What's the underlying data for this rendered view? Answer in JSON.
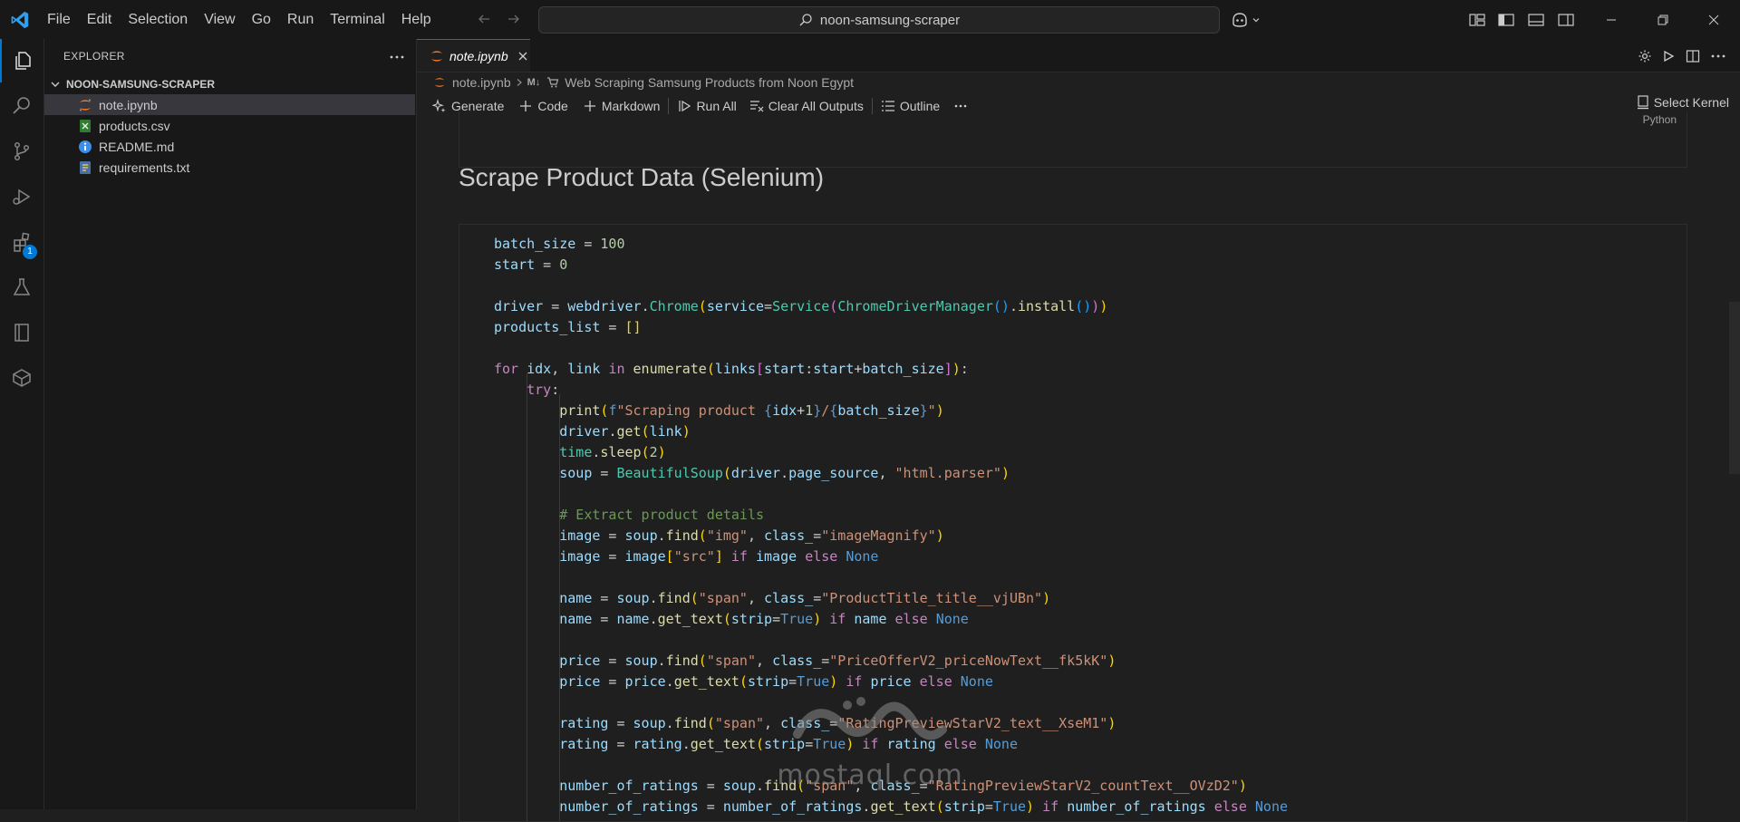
{
  "menu": [
    "File",
    "Edit",
    "Selection",
    "View",
    "Go",
    "Run",
    "Terminal",
    "Help"
  ],
  "command_center": {
    "text": "noon-samsung-scraper"
  },
  "activity_bar": {
    "extensions_badge": "1"
  },
  "sidebar": {
    "title": "EXPLORER",
    "folder": "NOON-SAMSUNG-SCRAPER",
    "files": [
      {
        "name": "note.ipynb",
        "icon": "jupyter-icon"
      },
      {
        "name": "products.csv",
        "icon": "csv-icon"
      },
      {
        "name": "README.md",
        "icon": "info-icon"
      },
      {
        "name": "requirements.txt",
        "icon": "python-file-icon"
      }
    ]
  },
  "tab": {
    "label": "note.ipynb"
  },
  "breadcrumb": {
    "file": "note.ipynb",
    "section_prefix": "M↓",
    "section": "Web Scraping Samsung Products from Noon Egypt"
  },
  "toolbar": {
    "generate": "Generate",
    "code": "Code",
    "markdown": "Markdown",
    "run_all": "Run All",
    "clear_all": "Clear All Outputs",
    "outline": "Outline",
    "select_kernel": "Select Kernel"
  },
  "cell": {
    "language": "Python"
  },
  "heading": "Scrape Product Data (Selenium)",
  "watermark": {
    "text": "mostaql.com"
  },
  "code_lines": [
    [
      [
        "v",
        "batch_size"
      ],
      [
        "",
        "&nbsp;= "
      ],
      [
        "n",
        "100"
      ]
    ],
    [
      [
        "v",
        "start"
      ],
      [
        "",
        "&nbsp;= "
      ],
      [
        "n",
        "0"
      ]
    ],
    [],
    [
      [
        "v",
        "driver"
      ],
      [
        "",
        "&nbsp;= "
      ],
      [
        "v",
        "webdriver"
      ],
      [
        "",
        "."
      ],
      [
        "c",
        "Chrome"
      ],
      [
        "p1",
        "("
      ],
      [
        "v",
        "service"
      ],
      [
        "",
        "="
      ],
      [
        "c",
        "Service"
      ],
      [
        "p2",
        "("
      ],
      [
        "c",
        "ChromeDriverManager"
      ],
      [
        "p3",
        "()"
      ],
      [
        "",
        "."
      ],
      [
        "f",
        "install"
      ],
      [
        "p3",
        "()"
      ],
      [
        "p2",
        ")"
      ],
      [
        "p1",
        ")"
      ]
    ],
    [
      [
        "v",
        "products_list"
      ],
      [
        "",
        "&nbsp;= "
      ],
      [
        "p1",
        "[]"
      ]
    ],
    [],
    [
      [
        "k",
        "for"
      ],
      [
        "",
        " "
      ],
      [
        "v",
        "idx"
      ],
      [
        "",
        ", "
      ],
      [
        "v",
        "link"
      ],
      [
        "",
        " "
      ],
      [
        "k",
        "in"
      ],
      [
        "",
        " "
      ],
      [
        "f",
        "enumerate"
      ],
      [
        "p1",
        "("
      ],
      [
        "v",
        "links"
      ],
      [
        "p2",
        "["
      ],
      [
        "v",
        "start"
      ],
      [
        "",
        ":"
      ],
      [
        "v",
        "start"
      ],
      [
        "",
        "+"
      ],
      [
        "v",
        "batch_size"
      ],
      [
        "p2",
        "]"
      ],
      [
        "p1",
        ")"
      ],
      [
        "",
        ":"
      ]
    ],
    [
      [
        "",
        "    "
      ],
      [
        "k",
        "try"
      ],
      [
        "",
        ":"
      ]
    ],
    [
      [
        "",
        "        "
      ],
      [
        "f",
        "print"
      ],
      [
        "p1",
        "("
      ],
      [
        "kb",
        "f"
      ],
      [
        "s",
        "\"Scraping product "
      ],
      [
        "kb",
        "{"
      ],
      [
        "v",
        "idx"
      ],
      [
        "",
        "+"
      ],
      [
        "n",
        "1"
      ],
      [
        "kb",
        "}"
      ],
      [
        "s",
        "/"
      ],
      [
        "kb",
        "{"
      ],
      [
        "v",
        "batch_size"
      ],
      [
        "kb",
        "}"
      ],
      [
        "s",
        "\""
      ],
      [
        "p1",
        ")"
      ]
    ],
    [
      [
        "",
        "        "
      ],
      [
        "v",
        "driver"
      ],
      [
        "",
        "."
      ],
      [
        "f",
        "get"
      ],
      [
        "p1",
        "("
      ],
      [
        "v",
        "link"
      ],
      [
        "p1",
        ")"
      ]
    ],
    [
      [
        "",
        "        "
      ],
      [
        "c",
        "time"
      ],
      [
        "",
        "."
      ],
      [
        "f",
        "sleep"
      ],
      [
        "p1",
        "("
      ],
      [
        "n",
        "2"
      ],
      [
        "p1",
        ")"
      ]
    ],
    [
      [
        "",
        "        "
      ],
      [
        "v",
        "soup"
      ],
      [
        "",
        "&nbsp;= "
      ],
      [
        "c",
        "BeautifulSoup"
      ],
      [
        "p1",
        "("
      ],
      [
        "v",
        "driver"
      ],
      [
        "",
        "."
      ],
      [
        "v",
        "page_source"
      ],
      [
        "",
        ", "
      ],
      [
        "s",
        "\"html.parser\""
      ],
      [
        "p1",
        ")"
      ]
    ],
    [],
    [
      [
        "",
        "        "
      ],
      [
        "cm",
        "# Extract product details"
      ]
    ],
    [
      [
        "",
        "        "
      ],
      [
        "v",
        "image"
      ],
      [
        "",
        "&nbsp;= "
      ],
      [
        "v",
        "soup"
      ],
      [
        "",
        "."
      ],
      [
        "f",
        "find"
      ],
      [
        "p1",
        "("
      ],
      [
        "s",
        "\"img\""
      ],
      [
        "",
        ", "
      ],
      [
        "v",
        "class_"
      ],
      [
        "",
        "="
      ],
      [
        "s",
        "\"imageMagnify\""
      ],
      [
        "p1",
        ")"
      ]
    ],
    [
      [
        "",
        "        "
      ],
      [
        "v",
        "image"
      ],
      [
        "",
        "&nbsp;= "
      ],
      [
        "v",
        "image"
      ],
      [
        "p1",
        "["
      ],
      [
        "s",
        "\"src\""
      ],
      [
        "p1",
        "]"
      ],
      [
        "",
        " "
      ],
      [
        "k",
        "if"
      ],
      [
        "",
        " "
      ],
      [
        "v",
        "image"
      ],
      [
        "",
        " "
      ],
      [
        "k",
        "else"
      ],
      [
        "",
        " "
      ],
      [
        "kb",
        "None"
      ]
    ],
    [],
    [
      [
        "",
        "        "
      ],
      [
        "v",
        "name"
      ],
      [
        "",
        "&nbsp;= "
      ],
      [
        "v",
        "soup"
      ],
      [
        "",
        "."
      ],
      [
        "f",
        "find"
      ],
      [
        "p1",
        "("
      ],
      [
        "s",
        "\"span\""
      ],
      [
        "",
        ", "
      ],
      [
        "v",
        "class_"
      ],
      [
        "",
        "="
      ],
      [
        "s",
        "\"ProductTitle_title__vjUBn\""
      ],
      [
        "p1",
        ")"
      ]
    ],
    [
      [
        "",
        "        "
      ],
      [
        "v",
        "name"
      ],
      [
        "",
        "&nbsp;= "
      ],
      [
        "v",
        "name"
      ],
      [
        "",
        "."
      ],
      [
        "f",
        "get_text"
      ],
      [
        "p1",
        "("
      ],
      [
        "v",
        "strip"
      ],
      [
        "",
        "="
      ],
      [
        "kb",
        "True"
      ],
      [
        "p1",
        ")"
      ],
      [
        "",
        " "
      ],
      [
        "k",
        "if"
      ],
      [
        "",
        " "
      ],
      [
        "v",
        "name"
      ],
      [
        "",
        " "
      ],
      [
        "k",
        "else"
      ],
      [
        "",
        " "
      ],
      [
        "kb",
        "None"
      ]
    ],
    [],
    [
      [
        "",
        "        "
      ],
      [
        "v",
        "price"
      ],
      [
        "",
        "&nbsp;= "
      ],
      [
        "v",
        "soup"
      ],
      [
        "",
        "."
      ],
      [
        "f",
        "find"
      ],
      [
        "p1",
        "("
      ],
      [
        "s",
        "\"span\""
      ],
      [
        "",
        ", "
      ],
      [
        "v",
        "class_"
      ],
      [
        "",
        "="
      ],
      [
        "s",
        "\"PriceOfferV2_priceNowText__fk5kK\""
      ],
      [
        "p1",
        ")"
      ]
    ],
    [
      [
        "",
        "        "
      ],
      [
        "v",
        "price"
      ],
      [
        "",
        "&nbsp;= "
      ],
      [
        "v",
        "price"
      ],
      [
        "",
        "."
      ],
      [
        "f",
        "get_text"
      ],
      [
        "p1",
        "("
      ],
      [
        "v",
        "strip"
      ],
      [
        "",
        "="
      ],
      [
        "kb",
        "True"
      ],
      [
        "p1",
        ")"
      ],
      [
        "",
        " "
      ],
      [
        "k",
        "if"
      ],
      [
        "",
        " "
      ],
      [
        "v",
        "price"
      ],
      [
        "",
        " "
      ],
      [
        "k",
        "else"
      ],
      [
        "",
        " "
      ],
      [
        "kb",
        "None"
      ]
    ],
    [],
    [
      [
        "",
        "        "
      ],
      [
        "v",
        "rating"
      ],
      [
        "",
        "&nbsp;= "
      ],
      [
        "v",
        "soup"
      ],
      [
        "",
        "."
      ],
      [
        "f",
        "find"
      ],
      [
        "p1",
        "("
      ],
      [
        "s",
        "\"span\""
      ],
      [
        "",
        ", "
      ],
      [
        "v",
        "class_"
      ],
      [
        "",
        "="
      ],
      [
        "s",
        "\"RatingPreviewStarV2_text__XseM1\""
      ],
      [
        "p1",
        ")"
      ]
    ],
    [
      [
        "",
        "        "
      ],
      [
        "v",
        "rating"
      ],
      [
        "",
        "&nbsp;= "
      ],
      [
        "v",
        "rating"
      ],
      [
        "",
        "."
      ],
      [
        "f",
        "get_text"
      ],
      [
        "p1",
        "("
      ],
      [
        "v",
        "strip"
      ],
      [
        "",
        "="
      ],
      [
        "kb",
        "True"
      ],
      [
        "p1",
        ")"
      ],
      [
        "",
        " "
      ],
      [
        "k",
        "if"
      ],
      [
        "",
        " "
      ],
      [
        "v",
        "rating"
      ],
      [
        "",
        " "
      ],
      [
        "k",
        "else"
      ],
      [
        "",
        " "
      ],
      [
        "kb",
        "None"
      ]
    ],
    [],
    [
      [
        "",
        "        "
      ],
      [
        "v",
        "number_of_ratings"
      ],
      [
        "",
        "&nbsp;= "
      ],
      [
        "v",
        "soup"
      ],
      [
        "",
        "."
      ],
      [
        "f",
        "find"
      ],
      [
        "p1",
        "("
      ],
      [
        "s",
        "\"span\""
      ],
      [
        "",
        ", "
      ],
      [
        "v",
        "class_"
      ],
      [
        "",
        "="
      ],
      [
        "s",
        "\"RatingPreviewStarV2_countText__OVzD2\""
      ],
      [
        "p1",
        ")"
      ]
    ],
    [
      [
        "",
        "        "
      ],
      [
        "v",
        "number_of_ratings"
      ],
      [
        "",
        "&nbsp;= "
      ],
      [
        "v",
        "number_of_ratings"
      ],
      [
        "",
        "."
      ],
      [
        "f",
        "get_text"
      ],
      [
        "p1",
        "("
      ],
      [
        "v",
        "strip"
      ],
      [
        "",
        "="
      ],
      [
        "kb",
        "True"
      ],
      [
        "p1",
        ")"
      ],
      [
        "",
        " "
      ],
      [
        "k",
        "if"
      ],
      [
        "",
        " "
      ],
      [
        "v",
        "number_of_ratings"
      ],
      [
        "",
        " "
      ],
      [
        "k",
        "else"
      ],
      [
        "",
        " "
      ],
      [
        "kb",
        "None"
      ]
    ]
  ]
}
